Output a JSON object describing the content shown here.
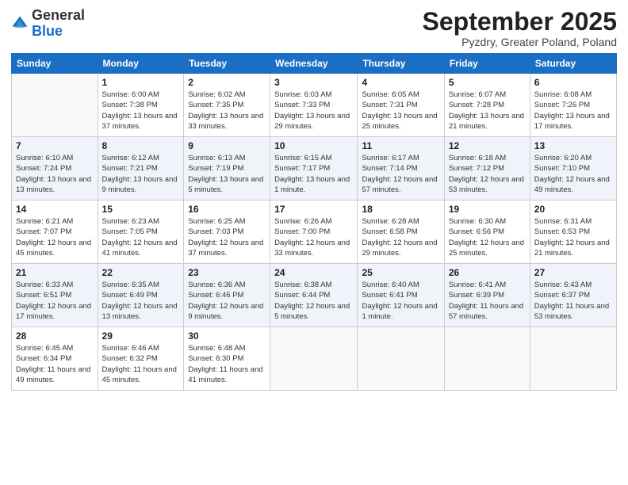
{
  "header": {
    "logo_general": "General",
    "logo_blue": "Blue",
    "month_title": "September 2025",
    "location": "Pyzdry, Greater Poland, Poland"
  },
  "weekdays": [
    "Sunday",
    "Monday",
    "Tuesday",
    "Wednesday",
    "Thursday",
    "Friday",
    "Saturday"
  ],
  "weeks": [
    [
      {
        "day": "",
        "sunrise": "",
        "sunset": "",
        "daylight": ""
      },
      {
        "day": "1",
        "sunrise": "Sunrise: 6:00 AM",
        "sunset": "Sunset: 7:38 PM",
        "daylight": "Daylight: 13 hours and 37 minutes."
      },
      {
        "day": "2",
        "sunrise": "Sunrise: 6:02 AM",
        "sunset": "Sunset: 7:35 PM",
        "daylight": "Daylight: 13 hours and 33 minutes."
      },
      {
        "day": "3",
        "sunrise": "Sunrise: 6:03 AM",
        "sunset": "Sunset: 7:33 PM",
        "daylight": "Daylight: 13 hours and 29 minutes."
      },
      {
        "day": "4",
        "sunrise": "Sunrise: 6:05 AM",
        "sunset": "Sunset: 7:31 PM",
        "daylight": "Daylight: 13 hours and 25 minutes."
      },
      {
        "day": "5",
        "sunrise": "Sunrise: 6:07 AM",
        "sunset": "Sunset: 7:28 PM",
        "daylight": "Daylight: 13 hours and 21 minutes."
      },
      {
        "day": "6",
        "sunrise": "Sunrise: 6:08 AM",
        "sunset": "Sunset: 7:26 PM",
        "daylight": "Daylight: 13 hours and 17 minutes."
      }
    ],
    [
      {
        "day": "7",
        "sunrise": "Sunrise: 6:10 AM",
        "sunset": "Sunset: 7:24 PM",
        "daylight": "Daylight: 13 hours and 13 minutes."
      },
      {
        "day": "8",
        "sunrise": "Sunrise: 6:12 AM",
        "sunset": "Sunset: 7:21 PM",
        "daylight": "Daylight: 13 hours and 9 minutes."
      },
      {
        "day": "9",
        "sunrise": "Sunrise: 6:13 AM",
        "sunset": "Sunset: 7:19 PM",
        "daylight": "Daylight: 13 hours and 5 minutes."
      },
      {
        "day": "10",
        "sunrise": "Sunrise: 6:15 AM",
        "sunset": "Sunset: 7:17 PM",
        "daylight": "Daylight: 13 hours and 1 minute."
      },
      {
        "day": "11",
        "sunrise": "Sunrise: 6:17 AM",
        "sunset": "Sunset: 7:14 PM",
        "daylight": "Daylight: 12 hours and 57 minutes."
      },
      {
        "day": "12",
        "sunrise": "Sunrise: 6:18 AM",
        "sunset": "Sunset: 7:12 PM",
        "daylight": "Daylight: 12 hours and 53 minutes."
      },
      {
        "day": "13",
        "sunrise": "Sunrise: 6:20 AM",
        "sunset": "Sunset: 7:10 PM",
        "daylight": "Daylight: 12 hours and 49 minutes."
      }
    ],
    [
      {
        "day": "14",
        "sunrise": "Sunrise: 6:21 AM",
        "sunset": "Sunset: 7:07 PM",
        "daylight": "Daylight: 12 hours and 45 minutes."
      },
      {
        "day": "15",
        "sunrise": "Sunrise: 6:23 AM",
        "sunset": "Sunset: 7:05 PM",
        "daylight": "Daylight: 12 hours and 41 minutes."
      },
      {
        "day": "16",
        "sunrise": "Sunrise: 6:25 AM",
        "sunset": "Sunset: 7:03 PM",
        "daylight": "Daylight: 12 hours and 37 minutes."
      },
      {
        "day": "17",
        "sunrise": "Sunrise: 6:26 AM",
        "sunset": "Sunset: 7:00 PM",
        "daylight": "Daylight: 12 hours and 33 minutes."
      },
      {
        "day": "18",
        "sunrise": "Sunrise: 6:28 AM",
        "sunset": "Sunset: 6:58 PM",
        "daylight": "Daylight: 12 hours and 29 minutes."
      },
      {
        "day": "19",
        "sunrise": "Sunrise: 6:30 AM",
        "sunset": "Sunset: 6:56 PM",
        "daylight": "Daylight: 12 hours and 25 minutes."
      },
      {
        "day": "20",
        "sunrise": "Sunrise: 6:31 AM",
        "sunset": "Sunset: 6:53 PM",
        "daylight": "Daylight: 12 hours and 21 minutes."
      }
    ],
    [
      {
        "day": "21",
        "sunrise": "Sunrise: 6:33 AM",
        "sunset": "Sunset: 6:51 PM",
        "daylight": "Daylight: 12 hours and 17 minutes."
      },
      {
        "day": "22",
        "sunrise": "Sunrise: 6:35 AM",
        "sunset": "Sunset: 6:49 PM",
        "daylight": "Daylight: 12 hours and 13 minutes."
      },
      {
        "day": "23",
        "sunrise": "Sunrise: 6:36 AM",
        "sunset": "Sunset: 6:46 PM",
        "daylight": "Daylight: 12 hours and 9 minutes."
      },
      {
        "day": "24",
        "sunrise": "Sunrise: 6:38 AM",
        "sunset": "Sunset: 6:44 PM",
        "daylight": "Daylight: 12 hours and 5 minutes."
      },
      {
        "day": "25",
        "sunrise": "Sunrise: 6:40 AM",
        "sunset": "Sunset: 6:41 PM",
        "daylight": "Daylight: 12 hours and 1 minute."
      },
      {
        "day": "26",
        "sunrise": "Sunrise: 6:41 AM",
        "sunset": "Sunset: 6:39 PM",
        "daylight": "Daylight: 11 hours and 57 minutes."
      },
      {
        "day": "27",
        "sunrise": "Sunrise: 6:43 AM",
        "sunset": "Sunset: 6:37 PM",
        "daylight": "Daylight: 11 hours and 53 minutes."
      }
    ],
    [
      {
        "day": "28",
        "sunrise": "Sunrise: 6:45 AM",
        "sunset": "Sunset: 6:34 PM",
        "daylight": "Daylight: 11 hours and 49 minutes."
      },
      {
        "day": "29",
        "sunrise": "Sunrise: 6:46 AM",
        "sunset": "Sunset: 6:32 PM",
        "daylight": "Daylight: 11 hours and 45 minutes."
      },
      {
        "day": "30",
        "sunrise": "Sunrise: 6:48 AM",
        "sunset": "Sunset: 6:30 PM",
        "daylight": "Daylight: 11 hours and 41 minutes."
      },
      {
        "day": "",
        "sunrise": "",
        "sunset": "",
        "daylight": ""
      },
      {
        "day": "",
        "sunrise": "",
        "sunset": "",
        "daylight": ""
      },
      {
        "day": "",
        "sunrise": "",
        "sunset": "",
        "daylight": ""
      },
      {
        "day": "",
        "sunrise": "",
        "sunset": "",
        "daylight": ""
      }
    ]
  ]
}
